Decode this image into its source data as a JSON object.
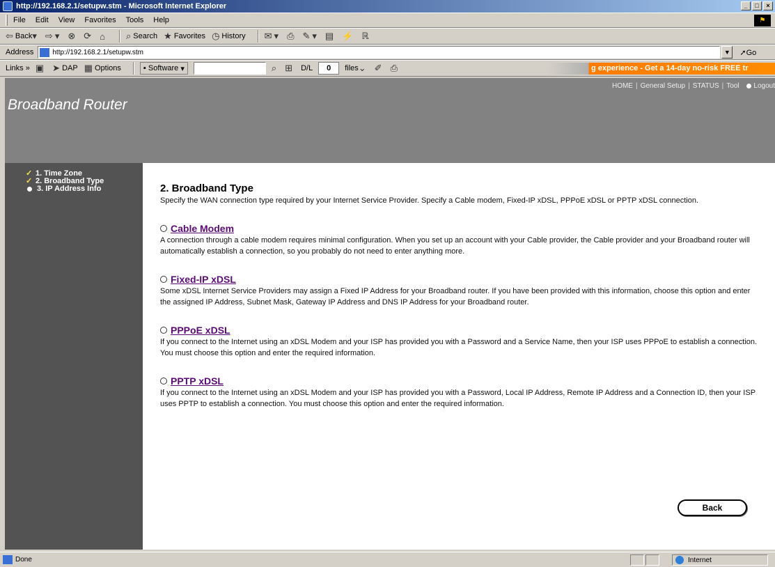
{
  "window": {
    "title": "http://192.168.2.1/setupw.stm - Microsoft Internet Explorer",
    "buttons": [
      "_",
      "□",
      "×"
    ]
  },
  "menu": [
    "File",
    "Edit",
    "View",
    "Favorites",
    "Tools",
    "Help"
  ],
  "toolbar": {
    "back": "Back",
    "search": "Search",
    "favorites": "Favorites",
    "history": "History"
  },
  "address": {
    "label": "Address",
    "url": "http://192.168.2.1/setupw.stm",
    "go": "Go"
  },
  "links_bar": {
    "label": "Links »",
    "dap": "DAP",
    "options": "Options",
    "software": "Software",
    "dl_label": "D/L",
    "dl_count": "0",
    "files": "files",
    "ad_text": "g experience - Get a 14-day no-risk FREE tr"
  },
  "router": {
    "title": "Broadband Router",
    "nav": [
      "HOME",
      "General Setup",
      "STATUS",
      "Tool",
      "Logout"
    ]
  },
  "steps": [
    {
      "label": "1. Time Zone",
      "state": "done"
    },
    {
      "label": "2. Broadband Type",
      "state": "done"
    },
    {
      "label": "3. IP Address Info",
      "state": "current"
    }
  ],
  "main": {
    "heading": "2. Broadband Type",
    "intro": "Specify the WAN connection type required by your Internet Service Provider. Specify a Cable modem, Fixed-IP xDSL, PPPoE xDSL or PPTP xDSL connection.",
    "options": [
      {
        "title": "Cable Modem",
        "desc": "A connection through a cable modem requires minimal configuration. When you set up an account with your Cable provider, the Cable provider and your Broadband router will automatically establish a connection, so you probably do not need to enter anything more."
      },
      {
        "title": "Fixed-IP xDSL",
        "desc": "Some xDSL Internet Service Providers may assign a Fixed IP Address for your Broadband router. If you have been provided with this information, choose this option and enter the assigned IP Address, Subnet Mask, Gateway IP Address and DNS IP Address for your Broadband router."
      },
      {
        "title": "PPPoE xDSL",
        "desc": "If you connect to the Internet using an xDSL Modem and your ISP has provided you with a Password and a Service Name, then your ISP uses PPPoE to establish a connection. You must choose this option and enter the required information."
      },
      {
        "title": "PPTP xDSL",
        "desc": "If you connect to the Internet using an xDSL Modem and your ISP has provided you with a Password, Local IP Address, Remote IP Address and a Connection ID, then your ISP uses PPTP to establish a connection. You must choose this option and enter the required information."
      }
    ],
    "back_button": "Back"
  },
  "status": {
    "text": "Done",
    "zone": "Internet"
  }
}
